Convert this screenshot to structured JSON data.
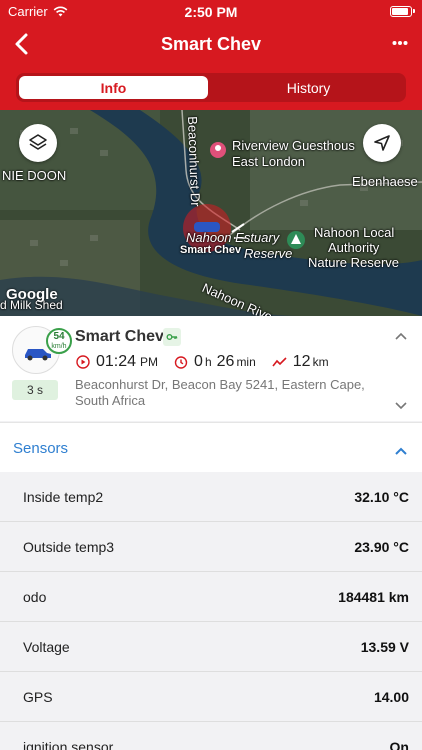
{
  "status_bar": {
    "carrier": "Carrier",
    "time": "2:50 PM"
  },
  "nav": {
    "title": "Smart Chev"
  },
  "tabs": [
    {
      "label": "Info",
      "active": true
    },
    {
      "label": "History",
      "active": false
    }
  ],
  "map": {
    "labels": {
      "street": "Beaconhurst Dr",
      "place1_line1": "Riverview Guesthous",
      "place1_line2": "East London",
      "area1": "NIE DOON",
      "area2": "Ebenhaese",
      "reserve1": "Nahoon Estuary",
      "reserve1b": "Reserve",
      "reserve2_line1": "Nahoon Local",
      "reserve2_line2": "Authority",
      "reserve2_line3": "Nature Reserve",
      "river": "Nahoon Rive",
      "shed": "d Milk Shed",
      "vehicle_marker": "Smart Chev"
    },
    "attribution": "Google",
    "colors": {
      "brand": "#d71920",
      "accent": "#2f7fd0",
      "green": "#3aa04a"
    }
  },
  "vehicle": {
    "name": "Smart Chev",
    "speed_value": "54",
    "speed_unit": "km/h",
    "stale_time": "3 s",
    "time_value": "01:24",
    "time_suffix": "PM",
    "stop_hours": "0",
    "stop_hours_unit": "h",
    "stop_minutes": "26",
    "stop_minutes_unit": "min",
    "distance_value": "12",
    "distance_unit": "km",
    "address": "Beaconhurst Dr, Beacon Bay 5241, Eastern Cape, South Africa"
  },
  "sensors": {
    "title": "Sensors",
    "rows": [
      {
        "label": "Inside temp2",
        "value": "32.10 °C"
      },
      {
        "label": "Outside temp3",
        "value": "23.90 °C"
      },
      {
        "label": "odo",
        "value": "184481 km"
      },
      {
        "label": "Voltage",
        "value": "13.59 V"
      },
      {
        "label": "GPS",
        "value": "14.00"
      },
      {
        "label": "ignition sensor",
        "value": "On"
      }
    ]
  }
}
